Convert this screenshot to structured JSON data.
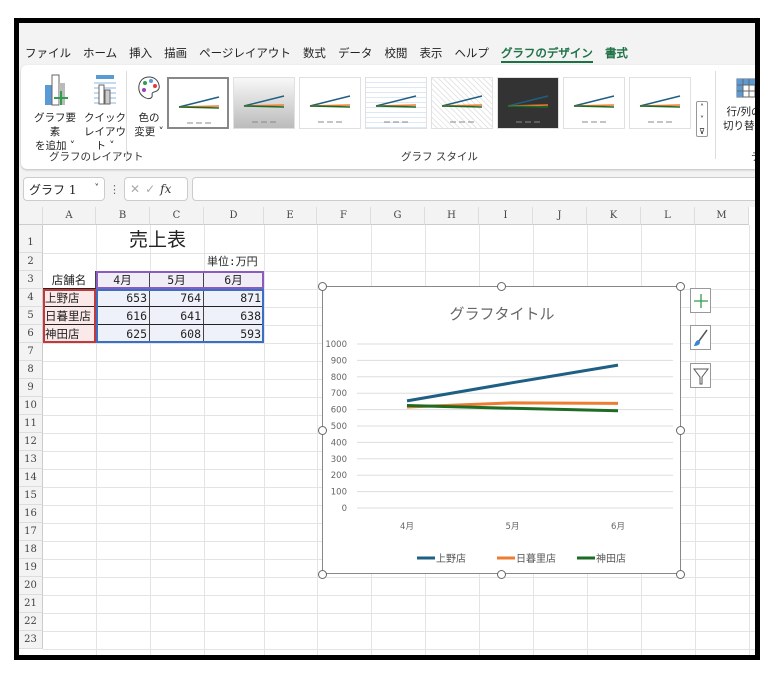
{
  "menu": {
    "tabs": [
      "ファイル",
      "ホーム",
      "挿入",
      "描画",
      "ページレイアウト",
      "数式",
      "データ",
      "校閲",
      "表示",
      "ヘルプ",
      "グラフのデザイン",
      "書式"
    ],
    "active": "グラフのデザイン"
  },
  "ribbon": {
    "add_element": [
      "グラフ要素",
      "を追加 ˅"
    ],
    "quick_layout": [
      "クイック",
      "レイアウト ˅"
    ],
    "change_color": [
      "色の",
      "変更 ˅"
    ],
    "group_layout": "グラフのレイアウト",
    "group_styles": "グラフ スタイル",
    "switch_rowcol": [
      "行/列の",
      "切り替え"
    ],
    "group_data": "デ"
  },
  "formula_bar": {
    "name_box": "グラフ 1",
    "fx": "fx",
    "value": ""
  },
  "columns": [
    "A",
    "B",
    "C",
    "D",
    "E",
    "F",
    "G",
    "H",
    "I",
    "J",
    "K",
    "L",
    "M"
  ],
  "rows": [
    "1",
    "2",
    "3",
    "4",
    "5",
    "6",
    "7",
    "8",
    "9",
    "10",
    "11",
    "12",
    "13",
    "14",
    "15",
    "16",
    "17",
    "18",
    "19",
    "20",
    "21",
    "22",
    "23"
  ],
  "sheet": {
    "title": "売上表",
    "unit": "単位:万円",
    "header": [
      "店舗名",
      "4月",
      "5月",
      "6月"
    ],
    "data": [
      [
        "上野店",
        "653",
        "764",
        "871"
      ],
      [
        "日暮里店",
        "616",
        "641",
        "638"
      ],
      [
        "神田店",
        "625",
        "608",
        "593"
      ]
    ]
  },
  "chart_data": {
    "type": "line",
    "title": "グラフタイトル",
    "categories": [
      "4月",
      "5月",
      "6月"
    ],
    "ylim": [
      0,
      1000
    ],
    "yticks": [
      "0",
      "100",
      "200",
      "300",
      "400",
      "500",
      "600",
      "700",
      "800",
      "900",
      "1000"
    ],
    "grid": true,
    "legend": "bottom",
    "series": [
      {
        "name": "上野店",
        "values": [
          653,
          764,
          871
        ],
        "color": "#1f5f84"
      },
      {
        "name": "日暮里店",
        "values": [
          616,
          641,
          638
        ],
        "color": "#ed7d31"
      },
      {
        "name": "神田店",
        "values": [
          625,
          608,
          593
        ],
        "color": "#1e6b24"
      }
    ]
  }
}
